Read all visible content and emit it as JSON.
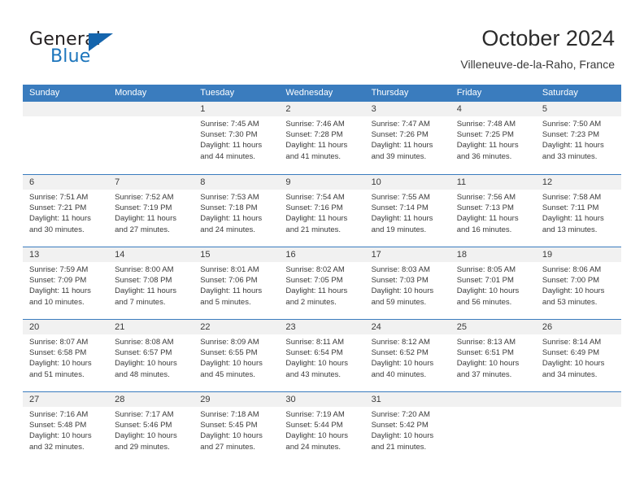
{
  "brand": {
    "line1": "General",
    "line2": "Blue",
    "triangle_color": "#1565ad",
    "blue_color": "#1c75bc"
  },
  "header": {
    "title": "October 2024",
    "subtitle": "Villeneuve-de-la-Raho, France"
  },
  "theme": {
    "header_blue": "#3a7cbe",
    "day_band_gray": "#f1f1f1",
    "text": "#3a3a3a"
  },
  "calendar": {
    "weekday_headers": [
      "Sunday",
      "Monday",
      "Tuesday",
      "Wednesday",
      "Thursday",
      "Friday",
      "Saturday"
    ],
    "weeks": [
      [
        {
          "day": "",
          "sunrise": "",
          "sunset": "",
          "daylight_line1": "",
          "daylight_line2": ""
        },
        {
          "day": "",
          "sunrise": "",
          "sunset": "",
          "daylight_line1": "",
          "daylight_line2": ""
        },
        {
          "day": "1",
          "sunrise": "Sunrise: 7:45 AM",
          "sunset": "Sunset: 7:30 PM",
          "daylight_line1": "Daylight: 11 hours",
          "daylight_line2": "and 44 minutes."
        },
        {
          "day": "2",
          "sunrise": "Sunrise: 7:46 AM",
          "sunset": "Sunset: 7:28 PM",
          "daylight_line1": "Daylight: 11 hours",
          "daylight_line2": "and 41 minutes."
        },
        {
          "day": "3",
          "sunrise": "Sunrise: 7:47 AM",
          "sunset": "Sunset: 7:26 PM",
          "daylight_line1": "Daylight: 11 hours",
          "daylight_line2": "and 39 minutes."
        },
        {
          "day": "4",
          "sunrise": "Sunrise: 7:48 AM",
          "sunset": "Sunset: 7:25 PM",
          "daylight_line1": "Daylight: 11 hours",
          "daylight_line2": "and 36 minutes."
        },
        {
          "day": "5",
          "sunrise": "Sunrise: 7:50 AM",
          "sunset": "Sunset: 7:23 PM",
          "daylight_line1": "Daylight: 11 hours",
          "daylight_line2": "and 33 minutes."
        }
      ],
      [
        {
          "day": "6",
          "sunrise": "Sunrise: 7:51 AM",
          "sunset": "Sunset: 7:21 PM",
          "daylight_line1": "Daylight: 11 hours",
          "daylight_line2": "and 30 minutes."
        },
        {
          "day": "7",
          "sunrise": "Sunrise: 7:52 AM",
          "sunset": "Sunset: 7:19 PM",
          "daylight_line1": "Daylight: 11 hours",
          "daylight_line2": "and 27 minutes."
        },
        {
          "day": "8",
          "sunrise": "Sunrise: 7:53 AM",
          "sunset": "Sunset: 7:18 PM",
          "daylight_line1": "Daylight: 11 hours",
          "daylight_line2": "and 24 minutes."
        },
        {
          "day": "9",
          "sunrise": "Sunrise: 7:54 AM",
          "sunset": "Sunset: 7:16 PM",
          "daylight_line1": "Daylight: 11 hours",
          "daylight_line2": "and 21 minutes."
        },
        {
          "day": "10",
          "sunrise": "Sunrise: 7:55 AM",
          "sunset": "Sunset: 7:14 PM",
          "daylight_line1": "Daylight: 11 hours",
          "daylight_line2": "and 19 minutes."
        },
        {
          "day": "11",
          "sunrise": "Sunrise: 7:56 AM",
          "sunset": "Sunset: 7:13 PM",
          "daylight_line1": "Daylight: 11 hours",
          "daylight_line2": "and 16 minutes."
        },
        {
          "day": "12",
          "sunrise": "Sunrise: 7:58 AM",
          "sunset": "Sunset: 7:11 PM",
          "daylight_line1": "Daylight: 11 hours",
          "daylight_line2": "and 13 minutes."
        }
      ],
      [
        {
          "day": "13",
          "sunrise": "Sunrise: 7:59 AM",
          "sunset": "Sunset: 7:09 PM",
          "daylight_line1": "Daylight: 11 hours",
          "daylight_line2": "and 10 minutes."
        },
        {
          "day": "14",
          "sunrise": "Sunrise: 8:00 AM",
          "sunset": "Sunset: 7:08 PM",
          "daylight_line1": "Daylight: 11 hours",
          "daylight_line2": "and 7 minutes."
        },
        {
          "day": "15",
          "sunrise": "Sunrise: 8:01 AM",
          "sunset": "Sunset: 7:06 PM",
          "daylight_line1": "Daylight: 11 hours",
          "daylight_line2": "and 5 minutes."
        },
        {
          "day": "16",
          "sunrise": "Sunrise: 8:02 AM",
          "sunset": "Sunset: 7:05 PM",
          "daylight_line1": "Daylight: 11 hours",
          "daylight_line2": "and 2 minutes."
        },
        {
          "day": "17",
          "sunrise": "Sunrise: 8:03 AM",
          "sunset": "Sunset: 7:03 PM",
          "daylight_line1": "Daylight: 10 hours",
          "daylight_line2": "and 59 minutes."
        },
        {
          "day": "18",
          "sunrise": "Sunrise: 8:05 AM",
          "sunset": "Sunset: 7:01 PM",
          "daylight_line1": "Daylight: 10 hours",
          "daylight_line2": "and 56 minutes."
        },
        {
          "day": "19",
          "sunrise": "Sunrise: 8:06 AM",
          "sunset": "Sunset: 7:00 PM",
          "daylight_line1": "Daylight: 10 hours",
          "daylight_line2": "and 53 minutes."
        }
      ],
      [
        {
          "day": "20",
          "sunrise": "Sunrise: 8:07 AM",
          "sunset": "Sunset: 6:58 PM",
          "daylight_line1": "Daylight: 10 hours",
          "daylight_line2": "and 51 minutes."
        },
        {
          "day": "21",
          "sunrise": "Sunrise: 8:08 AM",
          "sunset": "Sunset: 6:57 PM",
          "daylight_line1": "Daylight: 10 hours",
          "daylight_line2": "and 48 minutes."
        },
        {
          "day": "22",
          "sunrise": "Sunrise: 8:09 AM",
          "sunset": "Sunset: 6:55 PM",
          "daylight_line1": "Daylight: 10 hours",
          "daylight_line2": "and 45 minutes."
        },
        {
          "day": "23",
          "sunrise": "Sunrise: 8:11 AM",
          "sunset": "Sunset: 6:54 PM",
          "daylight_line1": "Daylight: 10 hours",
          "daylight_line2": "and 43 minutes."
        },
        {
          "day": "24",
          "sunrise": "Sunrise: 8:12 AM",
          "sunset": "Sunset: 6:52 PM",
          "daylight_line1": "Daylight: 10 hours",
          "daylight_line2": "and 40 minutes."
        },
        {
          "day": "25",
          "sunrise": "Sunrise: 8:13 AM",
          "sunset": "Sunset: 6:51 PM",
          "daylight_line1": "Daylight: 10 hours",
          "daylight_line2": "and 37 minutes."
        },
        {
          "day": "26",
          "sunrise": "Sunrise: 8:14 AM",
          "sunset": "Sunset: 6:49 PM",
          "daylight_line1": "Daylight: 10 hours",
          "daylight_line2": "and 34 minutes."
        }
      ],
      [
        {
          "day": "27",
          "sunrise": "Sunrise: 7:16 AM",
          "sunset": "Sunset: 5:48 PM",
          "daylight_line1": "Daylight: 10 hours",
          "daylight_line2": "and 32 minutes."
        },
        {
          "day": "28",
          "sunrise": "Sunrise: 7:17 AM",
          "sunset": "Sunset: 5:46 PM",
          "daylight_line1": "Daylight: 10 hours",
          "daylight_line2": "and 29 minutes."
        },
        {
          "day": "29",
          "sunrise": "Sunrise: 7:18 AM",
          "sunset": "Sunset: 5:45 PM",
          "daylight_line1": "Daylight: 10 hours",
          "daylight_line2": "and 27 minutes."
        },
        {
          "day": "30",
          "sunrise": "Sunrise: 7:19 AM",
          "sunset": "Sunset: 5:44 PM",
          "daylight_line1": "Daylight: 10 hours",
          "daylight_line2": "and 24 minutes."
        },
        {
          "day": "31",
          "sunrise": "Sunrise: 7:20 AM",
          "sunset": "Sunset: 5:42 PM",
          "daylight_line1": "Daylight: 10 hours",
          "daylight_line2": "and 21 minutes."
        },
        {
          "day": "",
          "sunrise": "",
          "sunset": "",
          "daylight_line1": "",
          "daylight_line2": ""
        },
        {
          "day": "",
          "sunrise": "",
          "sunset": "",
          "daylight_line1": "",
          "daylight_line2": ""
        }
      ]
    ]
  }
}
